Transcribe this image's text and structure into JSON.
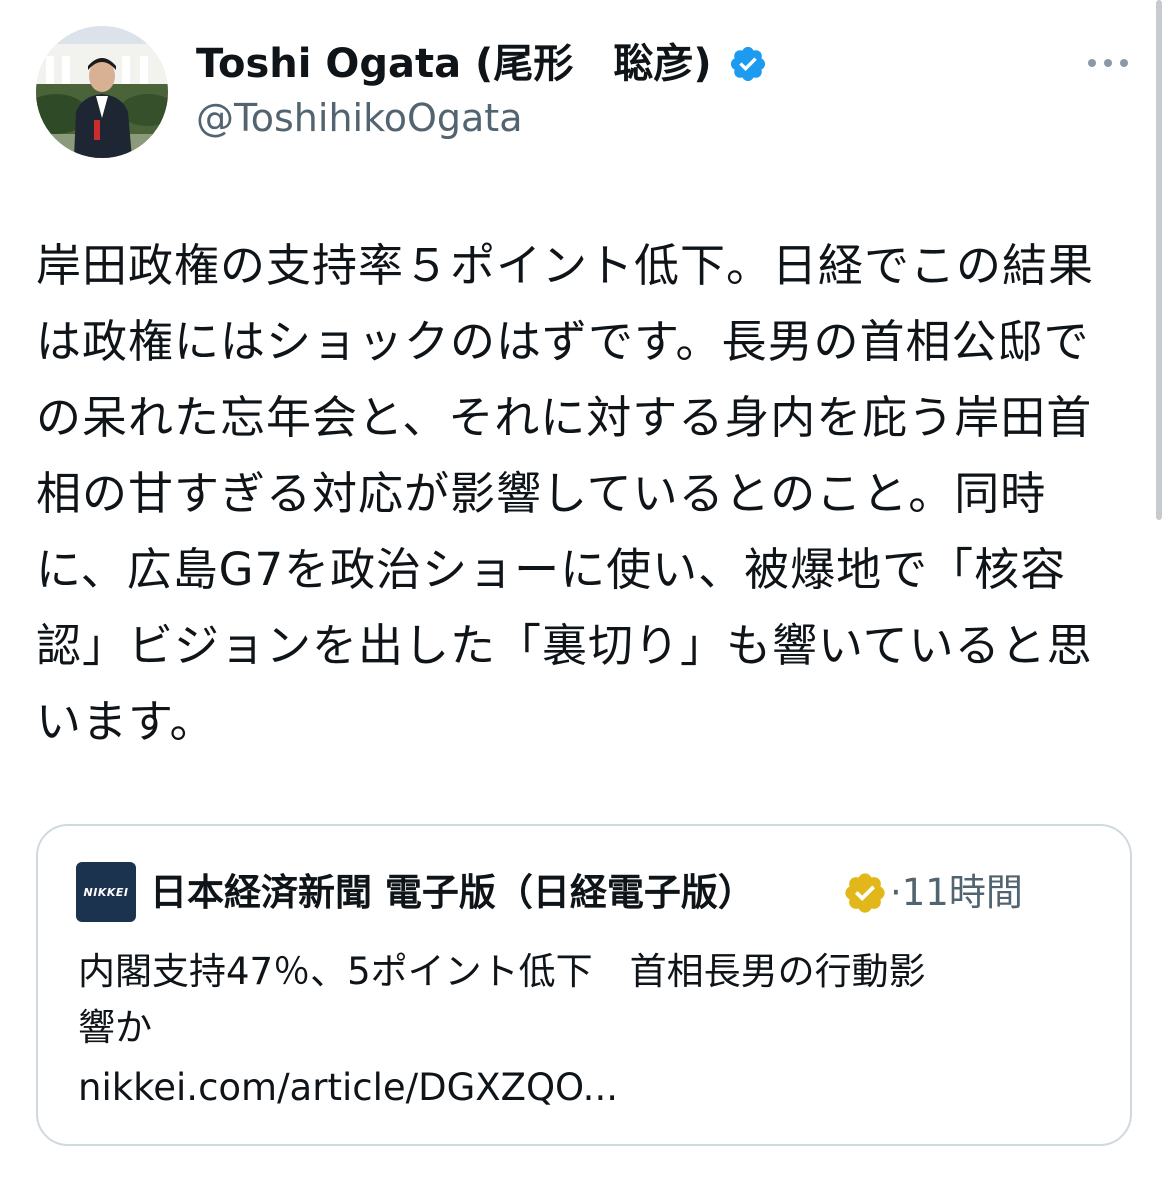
{
  "author": {
    "display_name": "Toshi Ogata (尾形　聡彦)",
    "handle": "@ToshihikoOgata",
    "verified": true,
    "verified_color": "#1d9bf0",
    "avatar_icon": "profile-photo"
  },
  "menu": {
    "more_icon": "ellipsis-icon"
  },
  "tweet": {
    "lines": [
      "岸田政権の支持率５ポイント低下。日経でこの結果",
      "は政権にはショックのはずです。長男の首相公邸で",
      "の呆れた忘年会と、それに対する身内を庇う岸田首",
      "相の甘すぎる対応が影響しているとのこと。同時",
      "に、広島G7を政治ショーに使い、被爆地で「核容",
      "認」ビジョンを出した「裏切り」も響いていると思",
      "います。"
    ]
  },
  "quote": {
    "logo_text": "NIKKEI",
    "account_name": "日本経済新聞 電子版（日経電子版）",
    "badge_color": "#e2b719",
    "time": "·11時間",
    "text_lines": [
      "内閣支持47％、5ポイント低下　首相長男の行動影",
      "響か"
    ],
    "link": "nikkei.com/article/DGXZQO..."
  }
}
